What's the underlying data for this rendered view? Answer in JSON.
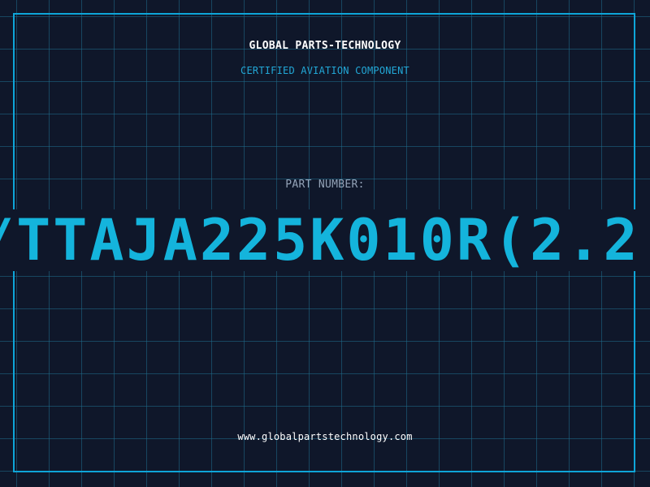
{
  "header": {
    "company_name": "GLOBAL PARTS-TECHNOLOGY",
    "tagline": "CERTIFIED AVIATION COMPONENT"
  },
  "part": {
    "label": "PART NUMBER:",
    "number": "/TTAJA225K010R(2.2"
  },
  "footer": {
    "website": "www.globalpartstechnology.com"
  },
  "colors": {
    "background": "#0f172a",
    "grid": "#1e6e8c",
    "accent": "#14b4dc",
    "label": "#94a3b8",
    "text": "#ffffff"
  }
}
